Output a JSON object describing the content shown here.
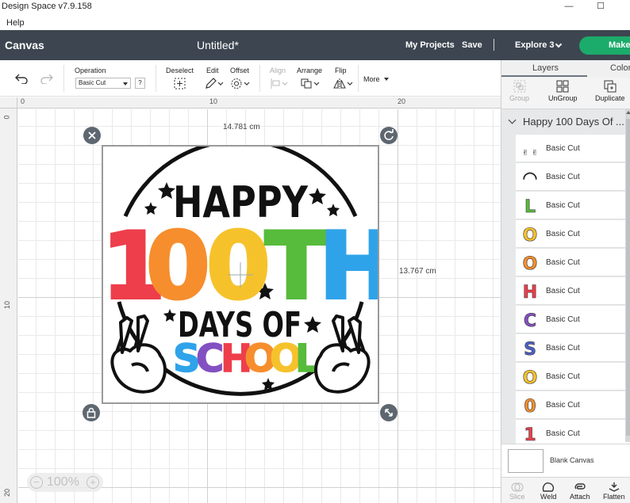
{
  "window": {
    "title": "Design Space  v7.9.158",
    "minimize": "—",
    "maximize": "☐"
  },
  "menu": {
    "help": "Help"
  },
  "header": {
    "canvas": "Canvas",
    "doc_title": "Untitled*",
    "my_projects": "My Projects",
    "save": "Save",
    "divider": "|",
    "machine": "Explore 3",
    "make": "Make"
  },
  "toolbar": {
    "operation_label": "Operation",
    "operation_value": "Basic Cut",
    "help": "?",
    "deselect": "Deselect",
    "edit": "Edit",
    "offset": "Offset",
    "align": "Align",
    "arrange": "Arrange",
    "flip": "Flip",
    "more": "More"
  },
  "rulers": {
    "top": [
      "0",
      "10",
      "20"
    ],
    "left": [
      "0",
      "10",
      "20"
    ]
  },
  "canvas": {
    "width_dim": "14.781 cm",
    "height_dim": "13.767 cm",
    "zoom": "100%",
    "design": {
      "happy": "HAPPY",
      "hundredth": [
        "1",
        "0",
        "0",
        "T",
        "H"
      ],
      "days_of": "DAYS OF",
      "school": [
        "S",
        "C",
        "H",
        "O",
        "O",
        "L"
      ],
      "colors": {
        "red": "#ee3e4b",
        "orange": "#f68e2d",
        "yellow": "#f6c22c",
        "green": "#57bb3b",
        "blue": "#2fa3ea",
        "indigo": "#4e5fc4",
        "purple": "#8350c1"
      }
    }
  },
  "panel": {
    "tabs": [
      "Layers",
      "Color"
    ],
    "tools": {
      "group": "Group",
      "ungroup": "UnGroup",
      "duplicate": "Duplicate"
    },
    "group_title": "Happy 100 Days Of ...",
    "layers": [
      {
        "glyph": "✌ ✌",
        "color": "#222222",
        "label": "Basic Cut"
      },
      {
        "glyph": "◠",
        "color": "#222222",
        "label": "Basic Cut"
      },
      {
        "glyph": "L",
        "color": "#57bb3b",
        "label": "Basic Cut"
      },
      {
        "glyph": "O",
        "color": "#f6c22c",
        "label": "Basic Cut"
      },
      {
        "glyph": "O",
        "color": "#f68e2d",
        "label": "Basic Cut"
      },
      {
        "glyph": "H",
        "color": "#ee3e4b",
        "label": "Basic Cut"
      },
      {
        "glyph": "C",
        "color": "#8350c1",
        "label": "Basic Cut"
      },
      {
        "glyph": "S",
        "color": "#4e5fc4",
        "label": "Basic Cut"
      },
      {
        "glyph": "O",
        "color": "#f6c22c",
        "label": "Basic Cut"
      },
      {
        "glyph": "0",
        "color": "#f68e2d",
        "label": "Basic Cut"
      },
      {
        "glyph": "1",
        "color": "#ee3e4b",
        "label": "Basic Cut"
      }
    ],
    "blank_canvas": "Blank Canvas",
    "bottom_tools": [
      "Slice",
      "Weld",
      "Attach",
      "Flatten"
    ]
  }
}
